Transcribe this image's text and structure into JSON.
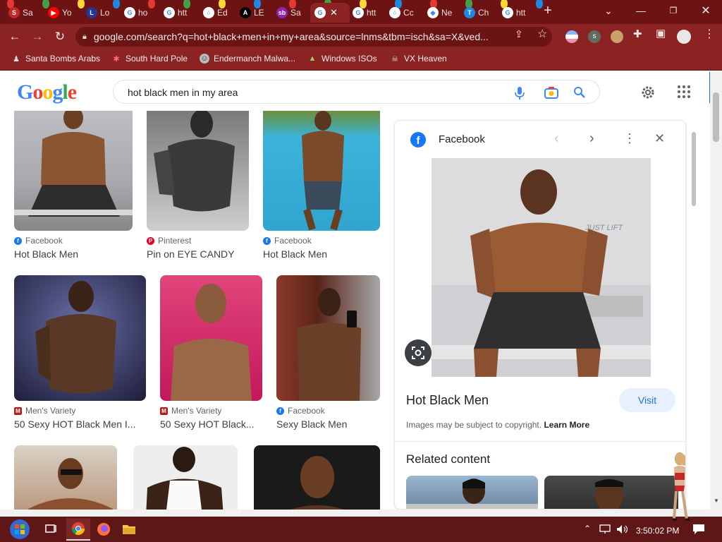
{
  "browser": {
    "tabs": [
      {
        "label": "Sa",
        "fav_color": "#c62828",
        "fav_glyph": "S"
      },
      {
        "label": "Yo",
        "fav_color": "#ff0000",
        "fav_glyph": "▶"
      },
      {
        "label": "Lo",
        "fav_color": "#283593",
        "fav_glyph": "L"
      },
      {
        "label": "ho",
        "fav_color": "#ffffff",
        "fav_glyph": "G"
      },
      {
        "label": "htt",
        "fav_color": "#ffffff",
        "fav_glyph": "G"
      },
      {
        "label": "Ed",
        "fav_color": "#ffffff",
        "fav_glyph": "○"
      },
      {
        "label": "LE",
        "fav_color": "#000000",
        "fav_glyph": "A"
      },
      {
        "label": "Sa",
        "fav_color": "#8e24aa",
        "fav_glyph": "sb"
      },
      {
        "label": "",
        "fav_color": "#ffffff",
        "fav_glyph": "G"
      },
      {
        "label": "htt",
        "fav_color": "#ffffff",
        "fav_glyph": "G"
      },
      {
        "label": "Cc",
        "fav_color": "#ffffff",
        "fav_glyph": "○"
      },
      {
        "label": "Ne",
        "fav_color": "#ffffff",
        "fav_glyph": "◆"
      },
      {
        "label": "Ch",
        "fav_color": "#1e88e5",
        "fav_glyph": "T"
      },
      {
        "label": "htt",
        "fav_color": "#ffffff",
        "fav_glyph": "G"
      }
    ],
    "new_tab_glyph": "+",
    "url": "google.com/search?q=hot+black+men+in+my+area&source=lnms&tbm=isch&sa=X&ved...",
    "bookmarks": [
      {
        "label": "Santa Bombs Arabs",
        "icon": "person-icon"
      },
      {
        "label": "South Hard Pole",
        "icon": "snowflake-icon"
      },
      {
        "label": "Endermanch Malwa...",
        "icon": "face-icon"
      },
      {
        "label": "Windows ISOs",
        "icon": "tree-icon"
      },
      {
        "label": "VX Heaven",
        "icon": "skull-icon"
      }
    ]
  },
  "google": {
    "logo": "Google",
    "query": "hot black men in my area"
  },
  "results": [
    {
      "source": "Facebook",
      "title": "Hot Black Men",
      "source_type": "facebook"
    },
    {
      "source": "Pinterest",
      "title": "Pin on EYE CANDY",
      "source_type": "pinterest"
    },
    {
      "source": "Facebook",
      "title": "Hot Black Men",
      "source_type": "facebook"
    },
    {
      "source": "Men's Variety",
      "title": "50 Sexy HOT Black Men I...",
      "source_type": "mensvariety"
    },
    {
      "source": "Men's Variety",
      "title": "50 Sexy HOT Black...",
      "source_type": "mensvariety"
    },
    {
      "source": "Facebook",
      "title": "Sexy Black Men",
      "source_type": "facebook"
    }
  ],
  "panel": {
    "source": "Facebook",
    "title": "Hot Black Men",
    "visit_label": "Visit",
    "copyright": "Images may be subject to copyright.",
    "learn_more": "Learn More",
    "related": "Related content"
  },
  "taskbar": {
    "clock": "3:50:02 PM"
  },
  "colors": {
    "tabstrip": "#6e1313",
    "toolbar": "#8c2323",
    "accent_blue": "#1a73e8"
  }
}
